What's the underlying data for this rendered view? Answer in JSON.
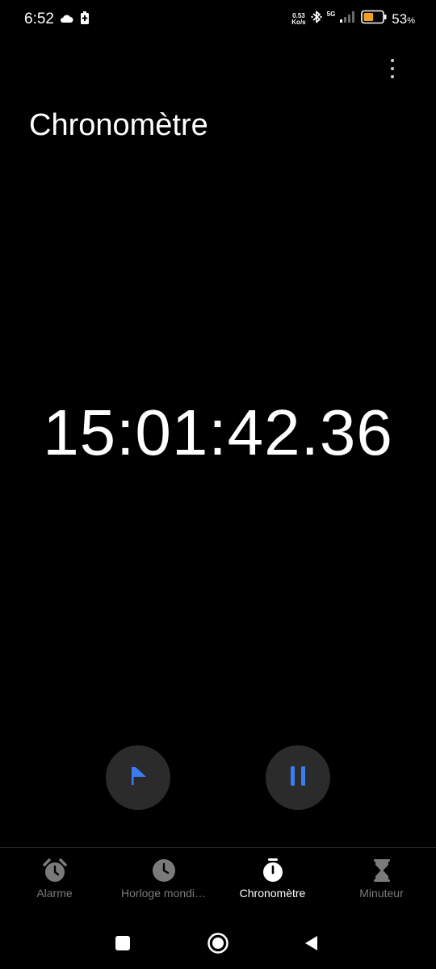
{
  "status_bar": {
    "time": "6:52",
    "net_speed_value": "0.53",
    "net_speed_unit": "Ko/s",
    "network_type": "5G",
    "battery_percent": "53",
    "battery_percent_sign": "%",
    "battery_level": 0.53,
    "battery_color": "#f0a020",
    "icons": [
      "cloud-icon",
      "battery-saver-icon",
      "bluetooth-icon",
      "signal-icon",
      "battery-icon"
    ]
  },
  "header": {
    "title": "Chronomètre",
    "more_icon": "more-vert-icon"
  },
  "stopwatch": {
    "time": "15:01:42.36"
  },
  "controls": {
    "lap_icon": "flag-icon",
    "pause_icon": "pause-icon",
    "accent_color": "#3b7cf2"
  },
  "bottom_nav": {
    "items": [
      {
        "label": "Alarme",
        "icon": "alarm-clock-icon",
        "active": false
      },
      {
        "label": "Horloge mondi…",
        "icon": "clock-icon",
        "active": false
      },
      {
        "label": "Chronomètre",
        "icon": "stopwatch-icon",
        "active": true
      },
      {
        "label": "Minuteur",
        "icon": "hourglass-icon",
        "active": false
      }
    ]
  },
  "system_nav": {
    "icons": [
      "recents-icon",
      "home-icon",
      "back-icon"
    ]
  }
}
